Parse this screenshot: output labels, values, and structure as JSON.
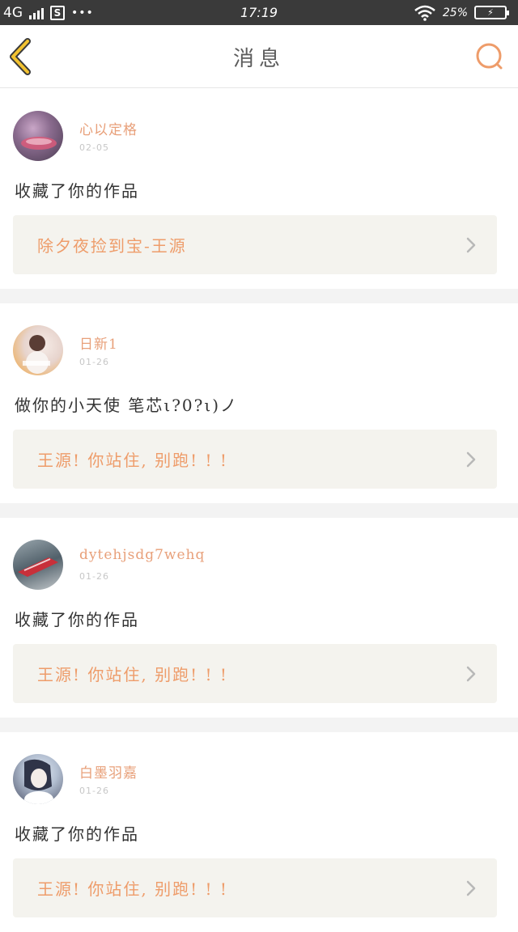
{
  "status_bar": {
    "network": "4G",
    "time": "17:19",
    "battery_percent": "25%"
  },
  "header": {
    "title": "消息"
  },
  "messages": [
    {
      "username": "心以定格",
      "date": "02-05",
      "action": "收藏了你的作品",
      "work_title": "除夕夜捡到宝-王源"
    },
    {
      "username": "日新1",
      "date": "01-26",
      "action": "做你的小天使 笔芯ι?0?ι)ノ",
      "work_title": "王源! 你站住, 别跑! ! !"
    },
    {
      "username": "dytehjsdg7wehq",
      "date": "01-26",
      "action": "收藏了你的作品",
      "work_title": "王源! 你站住, 别跑! ! !"
    },
    {
      "username": "白墨羽嘉",
      "date": "01-26",
      "action": "收藏了你的作品",
      "work_title": "王源! 你站住, 别跑! ! !"
    }
  ],
  "colors": {
    "accent": "#ee9c6a",
    "back_icon": "#f2c230",
    "card_bg": "#f4f3ee"
  }
}
